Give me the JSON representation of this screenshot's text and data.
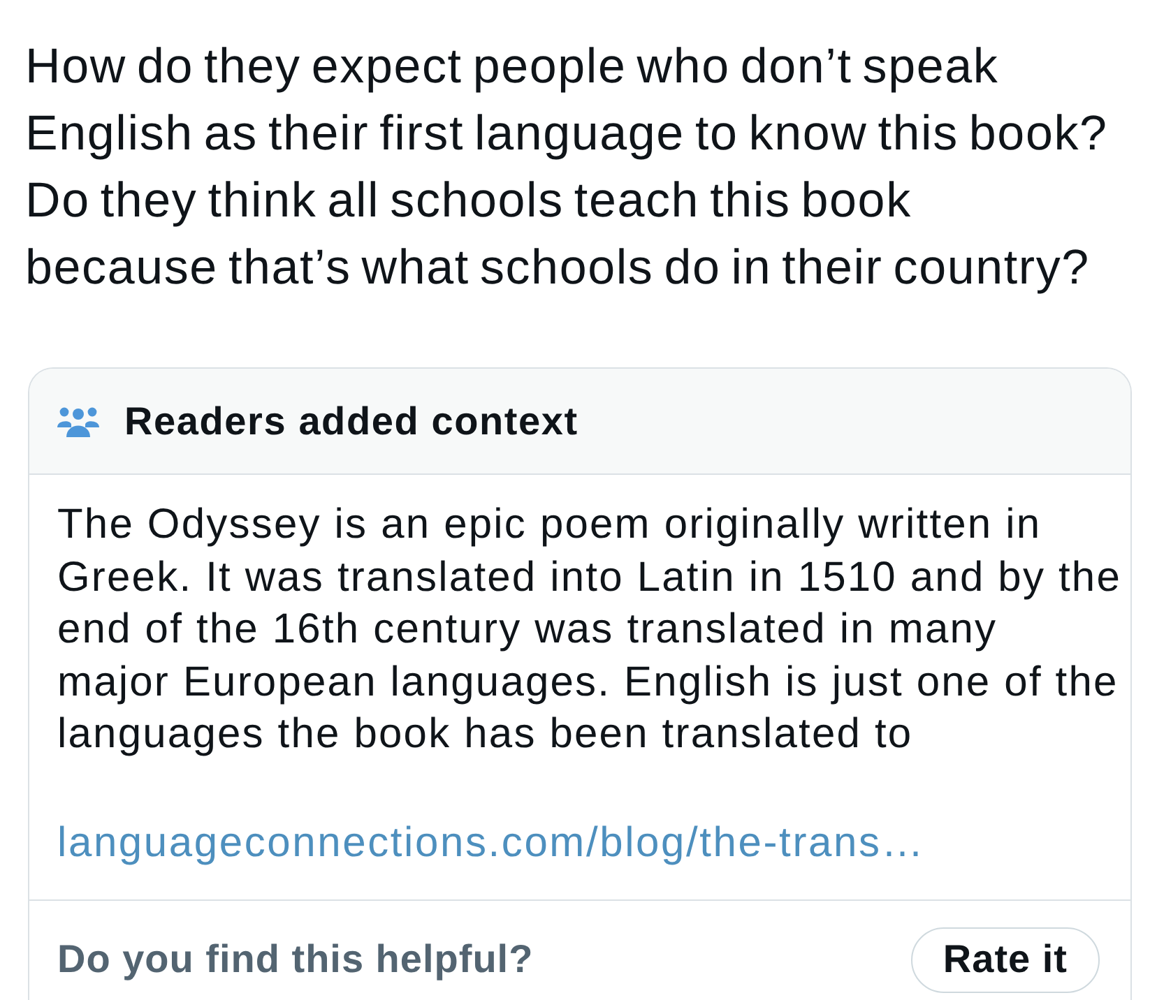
{
  "post": {
    "text": "How do they expect people who don’t speak English as their first language to know this book? Do they think all schools teach this book because that’s what schools do in their country?"
  },
  "context_note": {
    "title": "Readers added context",
    "body": "The Odyssey is an epic poem originally written in Greek. It was translated into Latin in 1510 and by the end of the 16th century was translated in many major European languages. English is just one of the languages the book has been translated to",
    "link": "languageconnections.com/blog/the-trans…",
    "prompt": "Do you find this helpful?",
    "rate_button": "Rate it"
  }
}
